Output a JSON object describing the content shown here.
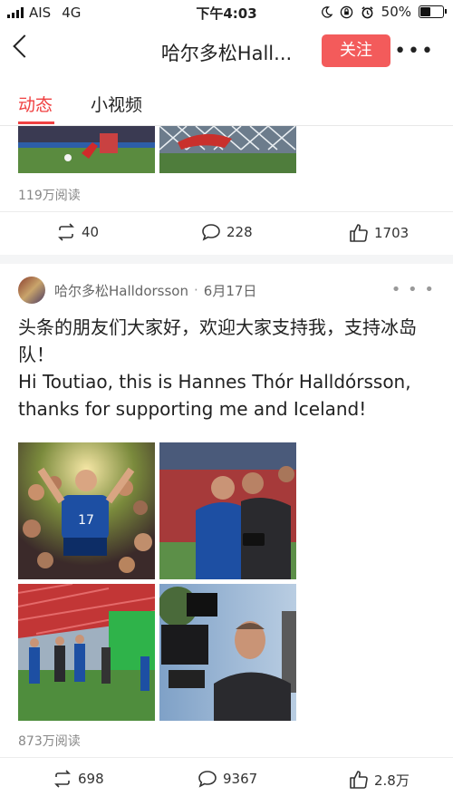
{
  "status_bar": {
    "carrier": "AIS",
    "network": "4G",
    "time": "下午4:03",
    "battery": "50%",
    "battery_level": 0.5
  },
  "nav": {
    "title": "哈尔多松Hall...",
    "follow_label": "关注"
  },
  "tabs": [
    {
      "label": "动态",
      "active": true
    },
    {
      "label": "小视频",
      "active": false
    }
  ],
  "post1": {
    "reads": "119万阅读",
    "repost_count": "40",
    "comment_count": "228",
    "like_count": "1703"
  },
  "post2": {
    "author": "哈尔多松Halldorsson",
    "separator": "·",
    "date": "6月17日",
    "text_cn": "头条的朋友们大家好，欢迎大家支持我，支持冰岛队！",
    "text_en": "Hi Toutiao, this is Hannes Thór Halldórsson, thanks for supporting me and Iceland!",
    "reads": "873万阅读",
    "repost_count": "698",
    "comment_count": "9367",
    "like_count": "2.8万"
  },
  "icons": {
    "back": "chevron-left",
    "more": "more-horizontal",
    "repost": "repost",
    "comment": "comment-bubble",
    "like": "thumbs-up"
  },
  "colors": {
    "accent": "#f04142",
    "follow_button": "#f35b5b",
    "jersey_blue": "#1d4fa3"
  }
}
